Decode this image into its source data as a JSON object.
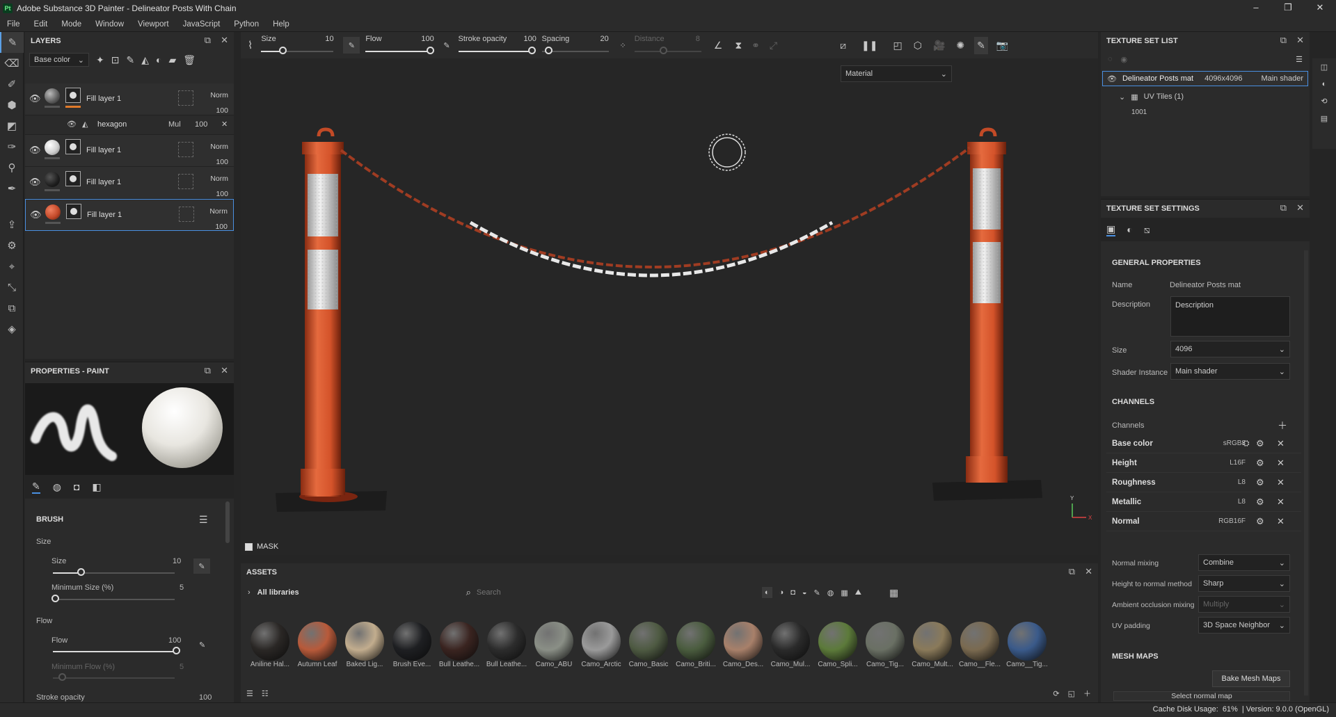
{
  "app": {
    "logo": "Pt",
    "title": "Adobe Substance 3D Painter - Delineator Posts With Chain"
  },
  "window_controls": {
    "minimize": "–",
    "maximize": "❐",
    "close": "✕"
  },
  "menu": [
    "File",
    "Edit",
    "Mode",
    "Window",
    "Viewport",
    "JavaScript",
    "Python",
    "Help"
  ],
  "layers": {
    "title": "LAYERS",
    "channel_select": "Base color",
    "items": [
      {
        "name": "Fill layer 1",
        "blend": "Norm",
        "opacity": "100",
        "ball": "#5a5a5a"
      },
      {
        "name": "hexagon",
        "blend": "Mul",
        "opacity": "100",
        "is_effect": true
      },
      {
        "name": "Fill layer 1",
        "blend": "Norm",
        "opacity": "100",
        "ball": "#cfcfcf"
      },
      {
        "name": "Fill layer 1",
        "blend": "Norm",
        "opacity": "100",
        "ball": "#1e1e1e"
      },
      {
        "name": "Fill layer 1",
        "blend": "Norm",
        "opacity": "100",
        "ball": "#c44a2a"
      }
    ]
  },
  "properties": {
    "title": "PROPERTIES - PAINT",
    "brush_title": "BRUSH",
    "size_section": "Size",
    "size_label": "Size",
    "size_value": "10",
    "min_size_label": "Minimum Size (%)",
    "min_size_value": "5",
    "flow_section": "Flow",
    "flow_label": "Flow",
    "flow_value": "100",
    "min_flow_label": "Minimum Flow (%)",
    "min_flow_value": "5",
    "stroke_opacity_label": "Stroke opacity",
    "stroke_opacity_value": "100"
  },
  "toolbar": {
    "size_label": "Size",
    "size_value": "10",
    "flow_label": "Flow",
    "flow_value": "100",
    "stroke_label": "Stroke opacity",
    "stroke_value": "100",
    "spacing_label": "Spacing",
    "spacing_value": "20",
    "distance_label": "Distance",
    "distance_value": "8"
  },
  "viewport": {
    "mode": "Material",
    "mask_label": "MASK",
    "axis_y": "Y",
    "axis_x": "X"
  },
  "assets": {
    "title": "ASSETS",
    "library": "All libraries",
    "search_placeholder": "Search",
    "materials": [
      {
        "name": "Aniline Hal...",
        "color": "#2a2725"
      },
      {
        "name": "Autumn Leaf",
        "color": "#b85a3a"
      },
      {
        "name": "Baked Lig...",
        "color": "#c2ad8e"
      },
      {
        "name": "Brush Eve...",
        "color": "#1e1f22"
      },
      {
        "name": "Bull Leathe...",
        "color": "#3a2420"
      },
      {
        "name": "Bull Leathe...",
        "color": "#2c2c2c"
      },
      {
        "name": "Camo_ABU",
        "color": "#8a8f86"
      },
      {
        "name": "Camo_Arctic",
        "color": "#9a9a9a"
      },
      {
        "name": "Camo_Basic",
        "color": "#4e5a42"
      },
      {
        "name": "Camo_Briti...",
        "color": "#4a5c3e"
      },
      {
        "name": "Camo_Des...",
        "color": "#a8806a"
      },
      {
        "name": "Camo_Mul...",
        "color": "#2a2a2a"
      },
      {
        "name": "Camo_Spli...",
        "color": "#5c7a3a"
      },
      {
        "name": "Camo_Tig...",
        "color": "#6a7064"
      },
      {
        "name": "Camo_Mult...",
        "color": "#8a7a5a"
      },
      {
        "name": "Camo__Fle...",
        "color": "#7a6a50"
      },
      {
        "name": "Camo__Tig...",
        "color": "#3a5a8a"
      }
    ]
  },
  "texture_set_list": {
    "title": "TEXTURE SET LIST",
    "set_name": "Delineator Posts mat",
    "set_size": "4096x4096",
    "set_shader": "Main shader",
    "uv_tiles": "UV Tiles (1)",
    "uv_tile_id": "1001"
  },
  "texture_set_settings": {
    "title": "TEXTURE SET SETTINGS",
    "general": "GENERAL PROPERTIES",
    "name_label": "Name",
    "name_value": "Delineator Posts mat",
    "desc_label": "Description",
    "desc_value": "Description",
    "size_label": "Size",
    "size_value": "4096",
    "shader_label": "Shader Instance",
    "shader_value": "Main shader",
    "channels_title": "CHANNELS",
    "channels_label": "Channels",
    "channels": [
      {
        "name": "Base color",
        "format": "sRGB8"
      },
      {
        "name": "Height",
        "format": "L16F"
      },
      {
        "name": "Roughness",
        "format": "L8"
      },
      {
        "name": "Metallic",
        "format": "L8"
      },
      {
        "name": "Normal",
        "format": "RGB16F"
      }
    ],
    "normal_mixing_label": "Normal mixing",
    "normal_mixing_value": "Combine",
    "h2n_label": "Height to normal method",
    "h2n_value": "Sharp",
    "ao_label": "Ambient occlusion mixing",
    "ao_value": "Multiply",
    "uv_padding_label": "UV padding",
    "uv_padding_value": "3D Space Neighbor",
    "mesh_maps_title": "MESH MAPS",
    "bake_button": "Bake Mesh Maps",
    "select_normal": "Select normal map"
  },
  "status": {
    "cache": "Cache Disk Usage:",
    "cache_value": "61%",
    "version": "| Version: 9.0.0 (OpenGL)"
  },
  "colors": {
    "accent": "#4a90e2",
    "post_orange": "#d4532a",
    "chain_dark": "#a03c22"
  }
}
